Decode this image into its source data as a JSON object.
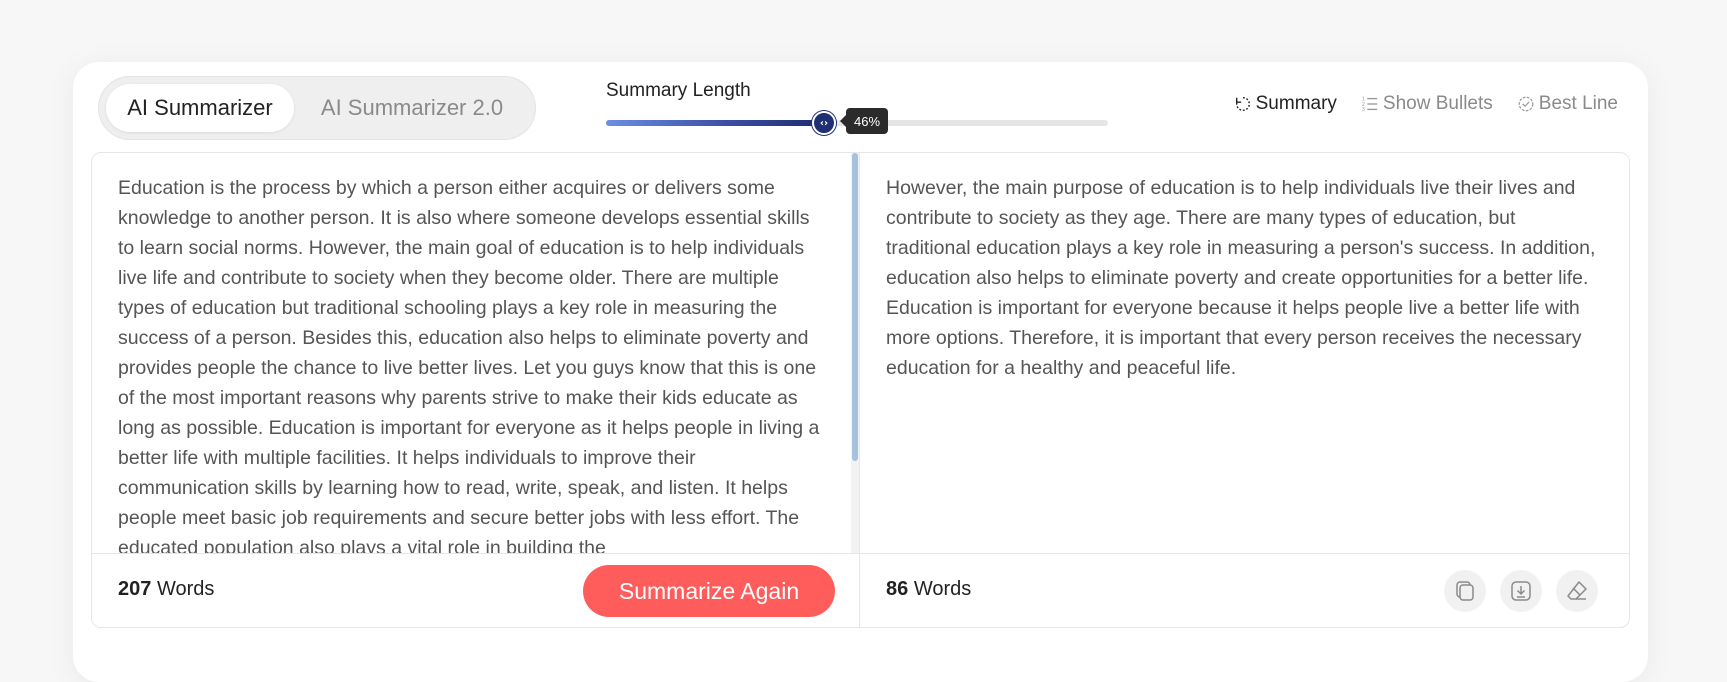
{
  "modes": {
    "active": "AI Summarizer",
    "inactive": "AI Summarizer 2.0"
  },
  "slider": {
    "label": "Summary Length",
    "value_percent": 46,
    "tooltip": "46%"
  },
  "view_options": [
    {
      "label": "Summary",
      "icon": "refresh-dotted-icon",
      "active": true
    },
    {
      "label": "Show Bullets",
      "icon": "numbered-list-icon",
      "active": false
    },
    {
      "label": "Best Line",
      "icon": "check-badge-icon",
      "active": false
    }
  ],
  "input": {
    "text": "Education is the process by which a person either acquires or delivers some knowledge to another person. It is also where someone develops essential skills to learn social norms. However, the main goal of education is to help individuals live life and contribute to society when they become older. There are multiple types of education but traditional schooling plays a key role in measuring the success of a person. Besides this, education also helps to eliminate poverty and provides people the chance to live better lives. Let you guys know that this is one of the most important reasons why parents strive to make their kids educate as long as possible. Education is important for everyone as it helps people in living a better life with multiple facilities. It helps individuals to improve their communication skills by learning how to read, write, speak, and listen. It helps people meet basic job requirements and secure better jobs with less effort. The educated population also plays a vital role in building the",
    "word_count": "207",
    "word_label": "Words",
    "button": "Summarize Again"
  },
  "output": {
    "text": "However, the main purpose of education is to help individuals live their lives and contribute to society as they age. There are many types of education, but traditional education plays a key role in measuring a person's success. In addition, education also helps to eliminate poverty and create opportunities for a better life. Education is important for everyone because it helps people live a better life with more options. Therefore, it is important that every person receives the necessary education for a healthy and peaceful life.",
    "word_count": "86",
    "word_label": "Words",
    "actions": [
      "copy-icon",
      "download-icon",
      "eraser-icon"
    ]
  },
  "colors": {
    "accent_button": "#ff5c5c",
    "slider_dark": "#1f2f73",
    "slider_light": "#6b8ee6"
  }
}
